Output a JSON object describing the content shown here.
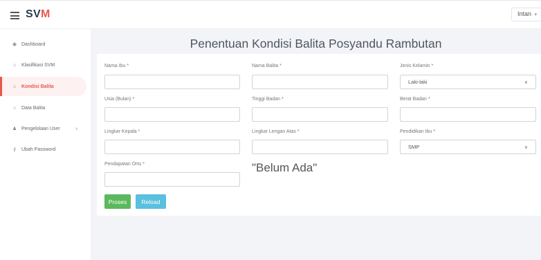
{
  "brand": {
    "part1": "SV",
    "part2": "M"
  },
  "user": {
    "name": "Intan",
    "caret": "▾"
  },
  "sidebar": {
    "items": [
      {
        "label": "Dashboard",
        "icon": "dashboard-icon",
        "glyph": "◉"
      },
      {
        "label": "Klasifikasi SVM",
        "icon": "home-icon",
        "glyph": "⌂"
      },
      {
        "label": "Kondisi Balita",
        "icon": "home-icon",
        "glyph": "⌂"
      },
      {
        "label": "Data Balita",
        "icon": "home-icon",
        "glyph": "⌂"
      },
      {
        "label": "Pengelolaan User",
        "icon": "users-icon",
        "glyph": "♟"
      },
      {
        "label": "Ubah Password",
        "icon": "key-icon",
        "glyph": "⚷"
      }
    ]
  },
  "page": {
    "title": "Penentuan Kondisi Balita Posyandu Rambutan"
  },
  "form": {
    "nama_ibu": {
      "label": "Nama Ibu",
      "value": ""
    },
    "nama_balita": {
      "label": "Nama Balita",
      "value": ""
    },
    "jenis_kelamin": {
      "label": "Jenis Kelamin",
      "value": "Laki-laki"
    },
    "usia": {
      "label": "Usia (Bulan)",
      "value": ""
    },
    "tinggi": {
      "label": "Tinggi Badan",
      "value": ""
    },
    "berat": {
      "label": "Berat Badan",
      "value": ""
    },
    "kepala": {
      "label": "Lingkar Kepala",
      "value": ""
    },
    "lengan": {
      "label": "Lingkar Lengan Atas",
      "value": ""
    },
    "pendidikan": {
      "label": "Pendidikan Ibu",
      "value": "SMP"
    },
    "pendapatan": {
      "label": "Pendapatan Ortu",
      "value": ""
    },
    "required_mark": "*",
    "result": "\"Belum Ada\"",
    "proses_label": "Proses",
    "reload_label": "Reload"
  },
  "colors": {
    "accent": "#e8584a",
    "proses": "#5cb85c",
    "reload": "#5bc0de"
  }
}
